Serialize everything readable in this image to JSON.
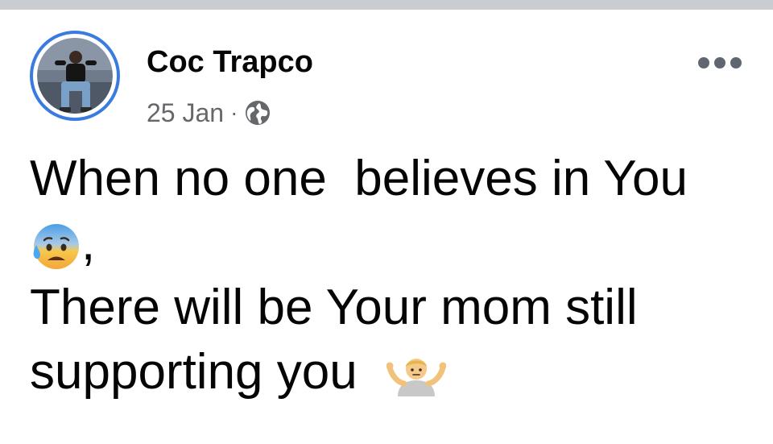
{
  "post": {
    "author": "Coc Trapco",
    "date": "25 Jan",
    "separator": "·",
    "privacy_icon": "globe-icon",
    "more_icon": "more-options-icon",
    "text_lines": [
      "When no one  believes in You",
      ",",
      "There will be Your mom still",
      "supporting you"
    ],
    "emojis": [
      "anxious-face-with-sweat",
      "person-shrugging"
    ]
  },
  "colors": {
    "top_bar": "#c9ccd1",
    "avatar_ring": "#3a7be0",
    "text": "#050505",
    "meta_text": "#65676b"
  }
}
